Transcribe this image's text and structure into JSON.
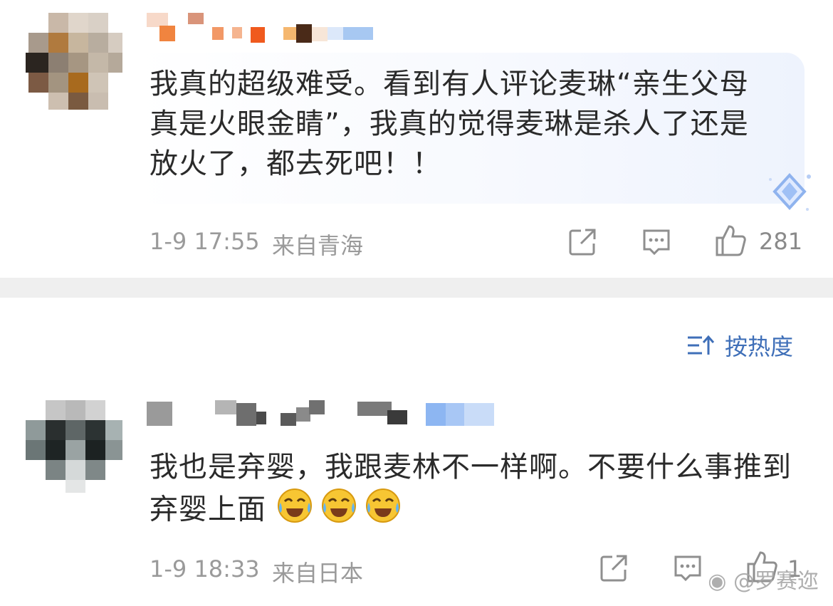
{
  "comments": [
    {
      "text": "我真的超级难受。看到有人评论麦琳“亲生父母真是火眼金睛”，我真的觉得麦琳是杀人了还是放火了，都去死吧！！",
      "time": "1-9 17:55",
      "location": "来自青海",
      "likes": "281"
    },
    {
      "text": "我也是弃婴，我跟麦林不一样啊。不要什么事推到弃婴上面",
      "time": "1-9 18:33",
      "location": "来自日本",
      "likes": "1"
    }
  ],
  "sort": {
    "label": "按热度",
    "icon": "sort-icon"
  },
  "watermark": "@罗赛迩",
  "icons": {
    "share": "share-icon",
    "reply": "comment-icon",
    "like": "thumbs-up-icon",
    "badge": "diamond-badge-icon",
    "emoji": "laugh-cry-emoji"
  },
  "colors": {
    "sort_accent": "#3f6fb8",
    "meta_gray": "#9a9a9a",
    "divider": "#efefef",
    "bubble_tint": "#eef3fd"
  }
}
